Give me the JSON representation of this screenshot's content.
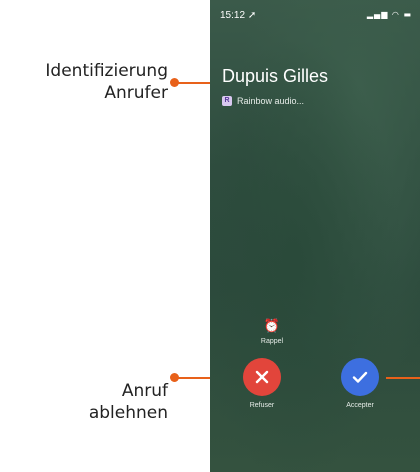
{
  "annotations": {
    "caller_id": "Identifizierung\nAnrufer",
    "reject_call": "Anruf\nablehnen"
  },
  "colors": {
    "accent": "#e8611a",
    "reject": "#e2453b",
    "accept": "#3d6fe0"
  },
  "phone": {
    "status_time": "15:12",
    "caller_name": "Dupuis Gilles",
    "app_label": "Rainbow audio...",
    "remind_label": "Rappel",
    "decline_label": "Refuser",
    "accept_label": "Accepter"
  }
}
